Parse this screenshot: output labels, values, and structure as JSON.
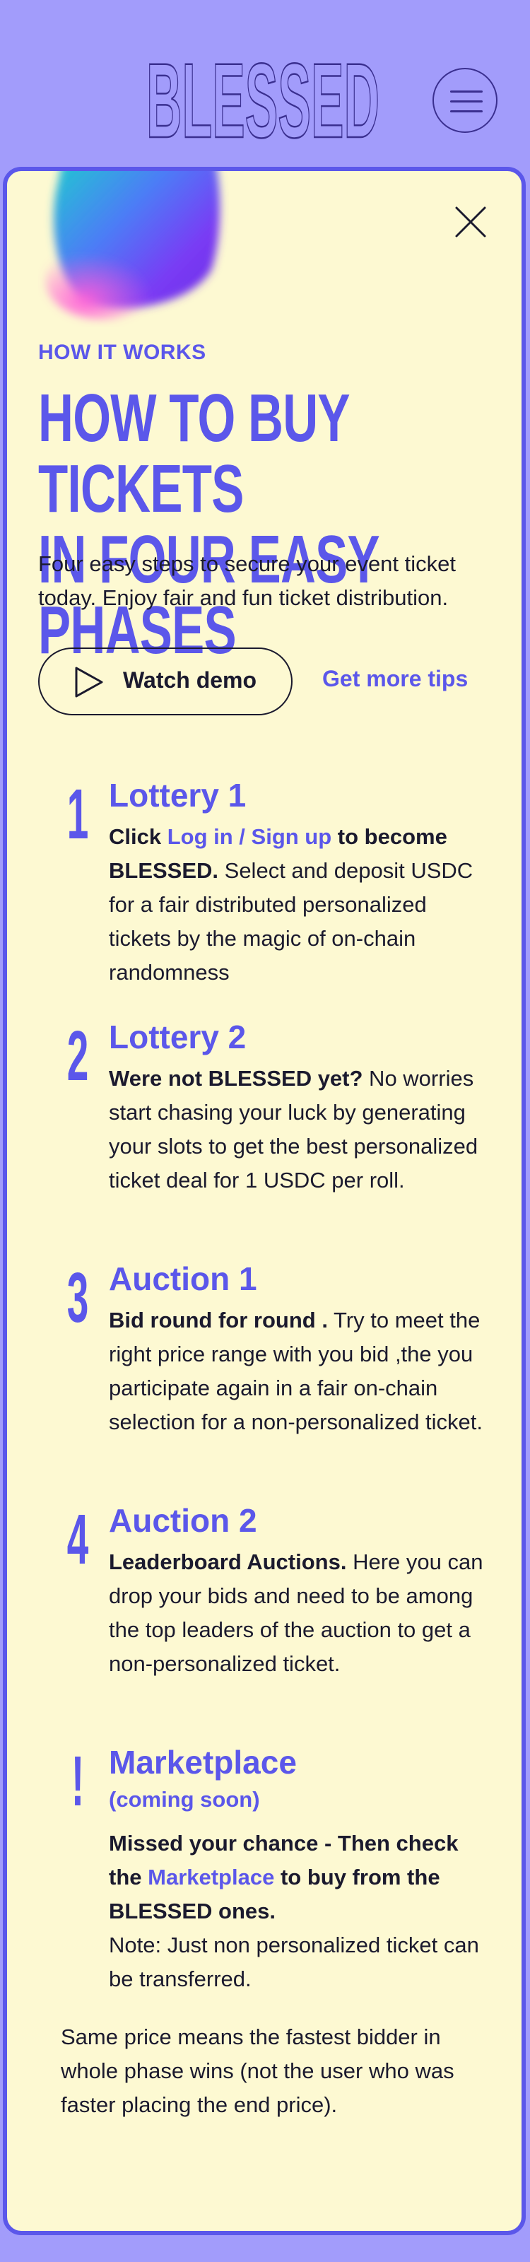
{
  "header": {
    "logo_text": "BLESSED",
    "menu_icon": "hamburger-icon"
  },
  "panel": {
    "close_icon": "close-icon",
    "eyebrow": "HOW IT WORKS",
    "headline_line1": "HOW TO BUY TICKETS",
    "headline_line2": "IN FOUR EASY PHASES",
    "subtitle": "Four easy steps to secure your event ticket today. Enjoy fair and fun ticket distribution.",
    "watch_demo_label": "Watch demo",
    "watch_demo_icon": "play-icon",
    "tips_link": "Get more tips"
  },
  "steps": [
    {
      "number": "1",
      "title": "Lottery 1",
      "body_prefix": "Click ",
      "body_link": "Log in / Sign up",
      "body_bold": " to become BLESSED.",
      "body_text": " Select and deposit USDC for a fair distributed personalized tickets by the magic of on-chain randomness"
    },
    {
      "number": "2",
      "title": "Lottery 2",
      "body_bold": "Were not BLESSED yet?",
      "body_text": " No worries start chasing your luck by generating your slots to get the best personalized ticket deal for 1 USDC per roll."
    },
    {
      "number": "3",
      "title": "Auction 1",
      "body_bold": "Bid round for round .",
      "body_text": " Try to meet the right price range with you bid ,the you  participate again in a fair on-chain selection for a non-personalized  ticket."
    },
    {
      "number": "4",
      "title": "Auction 2",
      "body_bold": "Leaderboard Auctions.",
      "body_text": " Here you can drop your bids and need to be among the top leaders of the auction to get a non-personalized ticket."
    },
    {
      "number": "!",
      "title": "Marketplace",
      "subtitle": "(coming soon)",
      "body_bold1": "Missed your chance - Then check the ",
      "body_link": "Marketplace",
      "body_bold2": " to buy from the BLESSED ones.",
      "body_text": "Note: Just non personalized ticket can be transferred."
    }
  ],
  "footnote": "Same price means the fastest bidder in whole phase wins (not the user who was faster placing the end price).",
  "colors": {
    "background": "#a29cfb",
    "panel": "#fdf9d2",
    "accent": "#5b57ea",
    "text": "#1b1a2e"
  }
}
